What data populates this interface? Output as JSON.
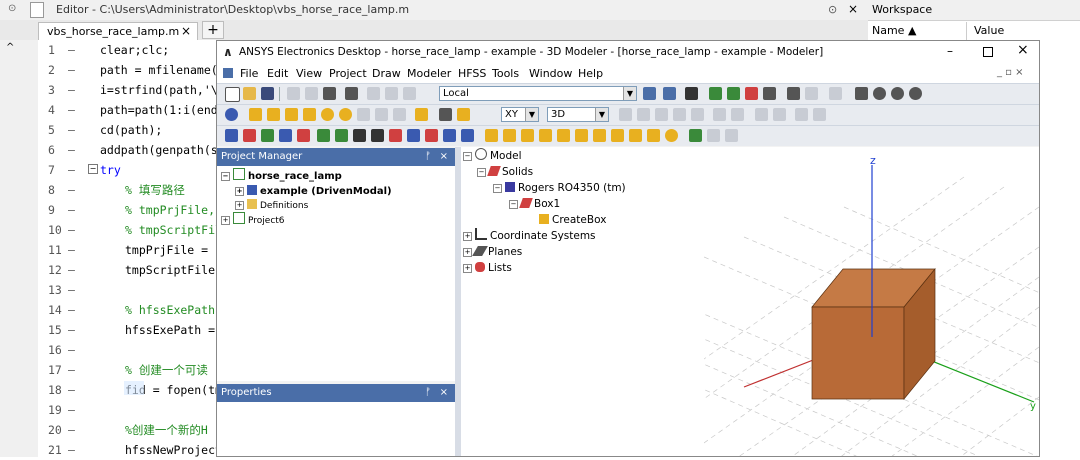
{
  "editor": {
    "title": "Editor - C:\\Users\\Administrator\\Desktop\\vbs_horse_race_lamp.m",
    "tab_label": "vbs_horse_race_lamp.m",
    "tab_close": "×",
    "plus": "+",
    "lines": [
      {
        "n": "1",
        "text": "clear;clc;"
      },
      {
        "n": "2",
        "text": "path = mfilename('"
      },
      {
        "n": "3",
        "text": "i=strfind(path,'\\'"
      },
      {
        "n": "4",
        "text": "path=path(1:i(end)"
      },
      {
        "n": "5",
        "text": "cd(path);"
      },
      {
        "n": "6",
        "text": "addpath(genpath(st"
      },
      {
        "n": "7",
        "text": "try"
      },
      {
        "n": "8",
        "text": "% 填写路径"
      },
      {
        "n": "9",
        "text": "% tmpPrjFile,"
      },
      {
        "n": "10",
        "text": "% tmpScriptFil"
      },
      {
        "n": "11",
        "text": "tmpPrjFile = '"
      },
      {
        "n": "12",
        "text": "tmpScriptFile"
      },
      {
        "n": "13",
        "text": ""
      },
      {
        "n": "14",
        "text": "% hfssExePath:"
      },
      {
        "n": "15",
        "text": "hfssExePath ="
      },
      {
        "n": "16",
        "text": ""
      },
      {
        "n": "17",
        "text": "% 创建一个可读"
      },
      {
        "n": "18",
        "text": "fid = fopen(tm"
      },
      {
        "n": "19",
        "text": ""
      },
      {
        "n": "20",
        "text": "%创建一个新的H"
      },
      {
        "n": "21",
        "text": "hfssNewProject"
      }
    ]
  },
  "workspace": {
    "title": "Workspace",
    "col_name": "Name ▲",
    "col_value": "Value"
  },
  "ansys": {
    "title": "ANSYS Electronics Desktop - horse_race_lamp - example - 3D Modeler - [horse_race_lamp - example - Modeler]",
    "menu": [
      "File",
      "Edit",
      "View",
      "Project",
      "Draw",
      "Modeler",
      "HFSS",
      "Tools",
      "Window",
      "Help"
    ],
    "coord_combo": "Local",
    "plane_combo": "XY",
    "mode_combo": "3D",
    "project_manager": {
      "title": "Project Manager",
      "root": "horse_race_lamp",
      "design": "example (DrivenModal)",
      "definitions": "Definitions",
      "project6": "Project6"
    },
    "properties_title": "Properties",
    "model_tree": {
      "model": "Model",
      "solids": "Solids",
      "material": "Rogers RO4350 (tm)",
      "box": "Box1",
      "create": "CreateBox",
      "coords": "Coordinate Systems",
      "planes": "Planes",
      "lists": "Lists"
    },
    "axis_z": "z",
    "axis_y": "y",
    "box_color": "#b86a37"
  }
}
